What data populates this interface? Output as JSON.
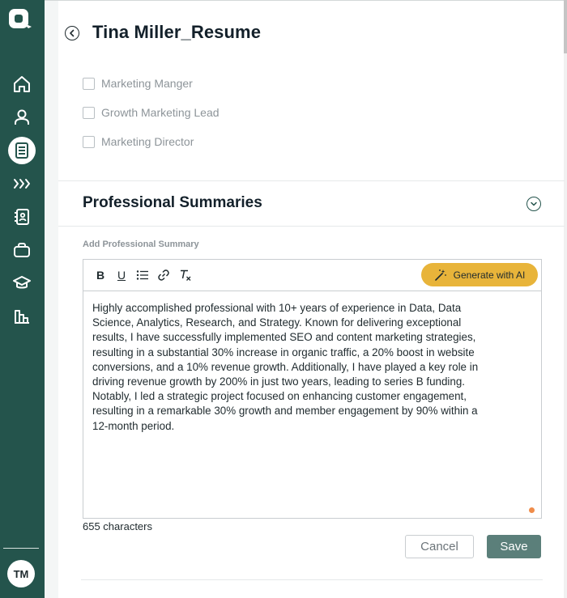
{
  "sidebar": {
    "logo_icon": "app-logo-icon",
    "items": [
      {
        "icon": "home-icon"
      },
      {
        "icon": "user-icon"
      },
      {
        "icon": "resume-icon",
        "active": true
      },
      {
        "icon": "chevrons-right-icon"
      },
      {
        "icon": "contacts-icon"
      },
      {
        "icon": "briefcase-icon"
      },
      {
        "icon": "graduation-cap-icon"
      },
      {
        "icon": "analytics-icon"
      }
    ],
    "avatar_initials": "TM"
  },
  "header": {
    "title": "Tina Miller_Resume"
  },
  "job_titles": [
    {
      "label": "Marketing Manger",
      "checked": false
    },
    {
      "label": "Growth Marketing Lead",
      "checked": false
    },
    {
      "label": "Marketing Director",
      "checked": false
    }
  ],
  "summary_section": {
    "title": "Professional Summaries",
    "field_label": "Add Professional Summary",
    "toolbar": {
      "bold": "B",
      "underline": "U",
      "generate_ai": "Generate with AI"
    },
    "text": "Highly accomplished professional with 10+ years of experience in Data, Data\nScience, Analytics, Research, and Strategy. Known for delivering exceptional\nresults, I have successfully implemented SEO and content marketing strategies,\nresulting in a substantial 30% increase in organic traffic, a 20% boost in website\nconversions, and a 10% revenue growth. Additionally, I have played a key role in\ndriving revenue growth by 200% in just two years, leading to series B funding.\nNotably, I led a strategic project focused on enhancing customer engagement,\nresulting in a remarkable 30% growth and member engagement by 90% within a\n12-month period.",
    "char_count": "655 characters",
    "cancel_label": "Cancel",
    "save_label": "Save"
  },
  "colors": {
    "sidebar": "#24544c",
    "accent": "#e8b43a",
    "save_button": "#5b7f7a"
  }
}
